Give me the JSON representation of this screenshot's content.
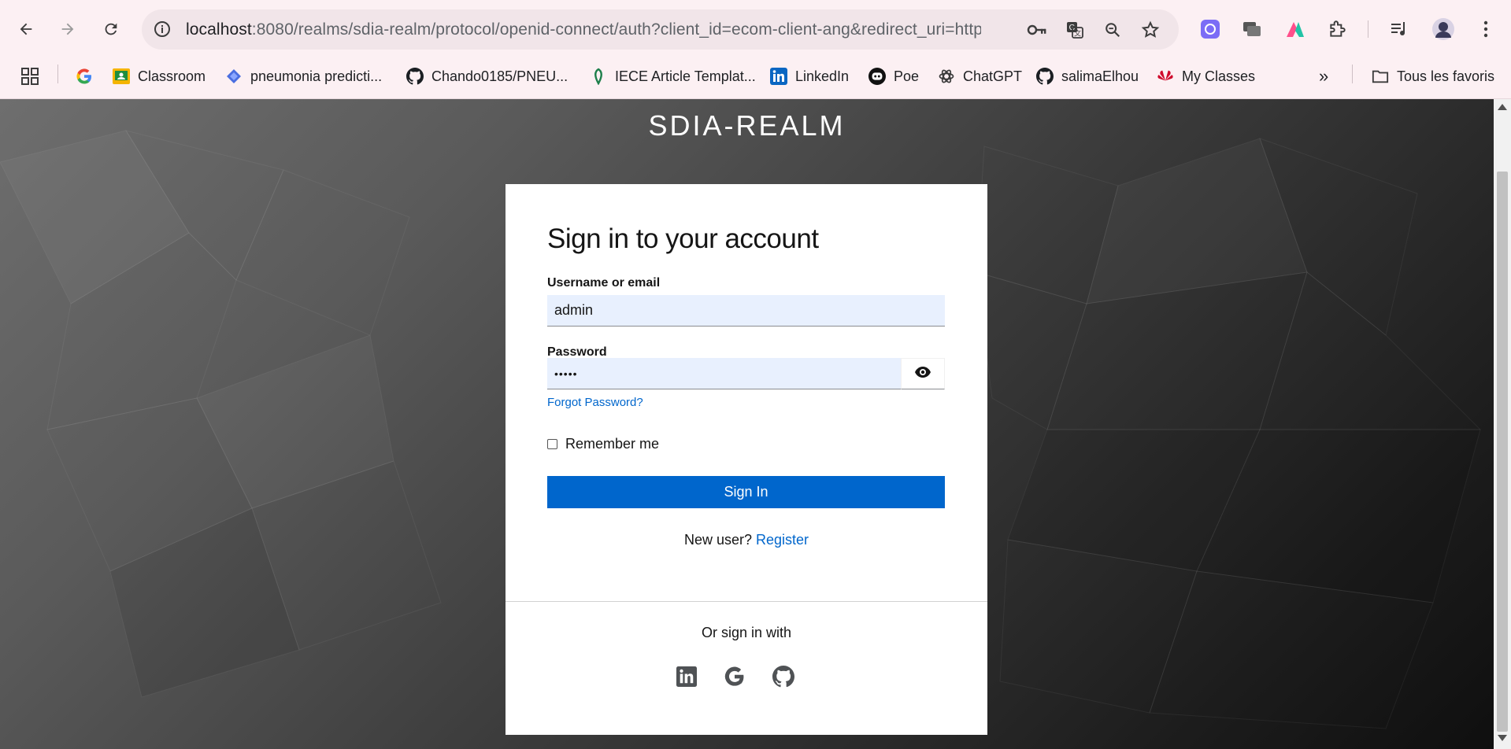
{
  "browser": {
    "url_host": "localhost",
    "url_rest": ":8080/realms/sdia-realm/protocol/openid-connect/auth?client_id=ecom-client-ang&redirect_uri=http...",
    "bookmarks": [
      {
        "label": "Classroom",
        "icon": "classroom-icon"
      },
      {
        "label": "pneumonia predicti...",
        "icon": "pneumonia-icon"
      },
      {
        "label": "Chando0185/PNEU...",
        "icon": "github-icon"
      },
      {
        "label": "IECE Article Templat...",
        "icon": "iece-icon"
      },
      {
        "label": "LinkedIn",
        "icon": "linkedin-icon"
      },
      {
        "label": "Poe",
        "icon": "poe-icon"
      },
      {
        "label": "ChatGPT",
        "icon": "chatgpt-icon"
      },
      {
        "label": "salimaElhou",
        "icon": "github-icon"
      },
      {
        "label": "My Classes",
        "icon": "huawei-icon"
      }
    ],
    "all_bookmarks_label": "Tous les favoris",
    "overflow_label": "»"
  },
  "page": {
    "realm_title": "SDIA-REALM",
    "heading": "Sign in to your account",
    "username_label": "Username or email",
    "username_value": "admin",
    "password_label": "Password",
    "password_value": "•••••",
    "forgot_password": "Forgot Password?",
    "remember_me": "Remember me",
    "signin_button": "Sign In",
    "new_user_text": "New user?",
    "register_link": "Register",
    "or_sign_in_with": "Or sign in with",
    "social_providers": [
      "linkedin",
      "google",
      "github"
    ]
  },
  "colors": {
    "primary": "#0066cc",
    "input_bg": "#e8f0fe",
    "chrome_bg": "#fcf0f3"
  }
}
